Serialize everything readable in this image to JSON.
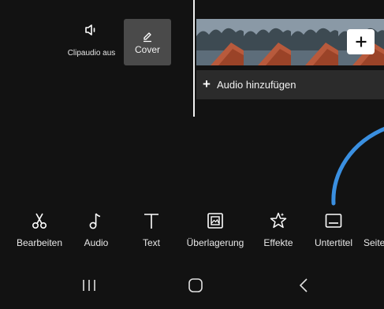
{
  "clip_audio": {
    "label": "Clipaudio aus",
    "icon": "speaker-muted-icon"
  },
  "cover": {
    "label": "Cover",
    "icon": "edit-pen-icon"
  },
  "timeline": {
    "add_clip_icon": "plus-icon",
    "add_audio_label": "Audio hinzufügen",
    "add_audio_plus": "+"
  },
  "toolbar": [
    {
      "label": "Bearbeiten",
      "icon": "scissors-icon"
    },
    {
      "label": "Audio",
      "icon": "music-note-icon"
    },
    {
      "label": "Text",
      "icon": "text-icon"
    },
    {
      "label": "Überlagerung",
      "icon": "overlay-image-icon"
    },
    {
      "label": "Effekte",
      "icon": "effects-star-icon"
    },
    {
      "label": "Untertitel",
      "icon": "subtitles-icon"
    },
    {
      "label": "Seite",
      "icon": ""
    }
  ],
  "navbar": {
    "recents_icon": "recents-icon",
    "home_icon": "home-icon",
    "back_icon": "back-icon"
  },
  "colors": {
    "background": "#121212",
    "accent_arc": "#3a8fe0",
    "audio_row": "#2b2b2b",
    "cover_bg": "#4a4a4a"
  }
}
